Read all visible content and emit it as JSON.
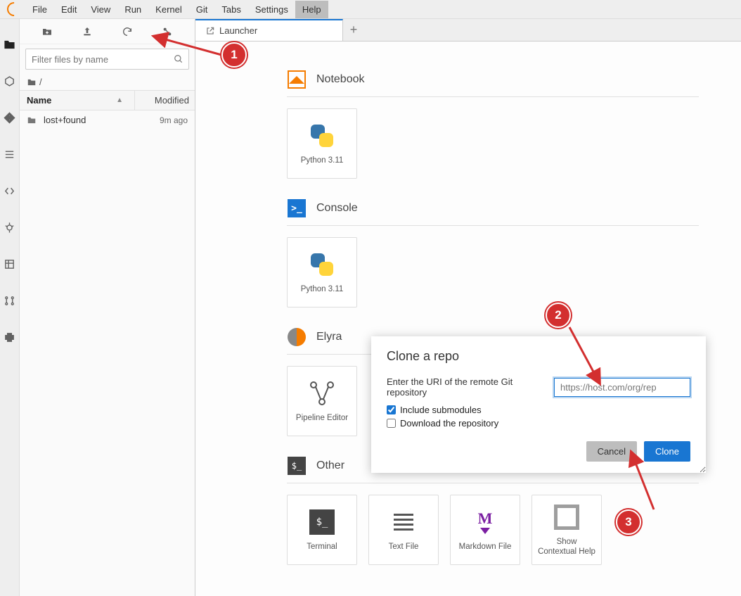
{
  "menubar": {
    "items": [
      "File",
      "Edit",
      "View",
      "Run",
      "Kernel",
      "Git",
      "Tabs",
      "Settings",
      "Help"
    ],
    "active_index": 8
  },
  "activitybar": {
    "items": [
      {
        "name": "folder-icon",
        "active": true
      },
      {
        "name": "hexagon-icon"
      },
      {
        "name": "git-icon"
      },
      {
        "name": "list-icon"
      },
      {
        "name": "code-icon"
      },
      {
        "name": "debug-icon"
      },
      {
        "name": "table-icon"
      },
      {
        "name": "component-icon"
      },
      {
        "name": "puzzle-icon"
      }
    ]
  },
  "sidebar": {
    "toolbar": [
      {
        "name": "new-folder-icon"
      },
      {
        "name": "upload-icon"
      },
      {
        "name": "refresh-icon"
      },
      {
        "name": "git-clone-icon"
      }
    ],
    "filter_placeholder": "Filter files by name",
    "breadcrumb_path": "/",
    "columns": {
      "name": "Name",
      "modified": "Modified"
    },
    "files": [
      {
        "name": "lost+found",
        "modified": "9m ago",
        "type": "folder"
      }
    ]
  },
  "tabs": {
    "items": [
      {
        "label": "Launcher",
        "icon": "launch-icon"
      }
    ],
    "add_label": "+"
  },
  "launcher": {
    "sections": [
      {
        "title": "Notebook",
        "icon": "notebook",
        "cards": [
          {
            "label": "Python 3.11",
            "icon": "python"
          }
        ]
      },
      {
        "title": "Console",
        "icon": "console",
        "cards": [
          {
            "label": "Python 3.11",
            "icon": "python"
          }
        ]
      },
      {
        "title": "Elyra",
        "icon": "elyra",
        "cards": [
          {
            "label": "Pipeline Editor",
            "icon": "pipeline"
          }
        ]
      },
      {
        "title": "Other",
        "icon": "other",
        "cards": [
          {
            "label": "Terminal",
            "icon": "terminal"
          },
          {
            "label": "Text File",
            "icon": "textfile"
          },
          {
            "label": "Markdown File",
            "icon": "markdown"
          },
          {
            "label": "Show Contextual Help",
            "icon": "help"
          }
        ]
      }
    ]
  },
  "dialog": {
    "title": "Clone a repo",
    "uri_label": "Enter the URI of the remote Git repository",
    "uri_placeholder": "https://host.com/org/rep",
    "checkbox_submodules": "Include submodules",
    "checkbox_submodules_checked": true,
    "checkbox_download": "Download the repository",
    "checkbox_download_checked": false,
    "btn_cancel": "Cancel",
    "btn_clone": "Clone"
  },
  "callouts": {
    "c1": "1",
    "c2": "2",
    "c3": "3"
  },
  "colors": {
    "primary": "#1976d2",
    "accent": "#f57c00",
    "danger": "#d32f2f"
  }
}
